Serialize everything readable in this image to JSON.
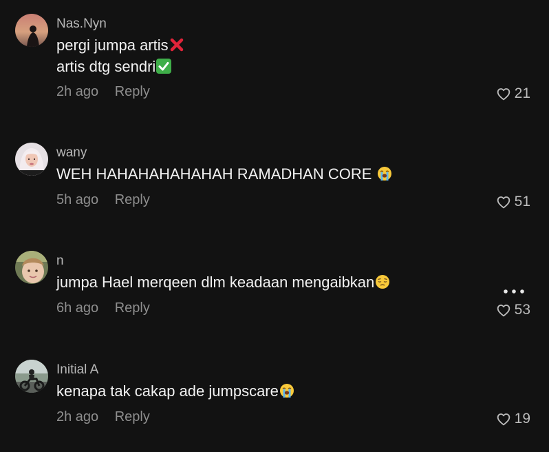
{
  "comments": [
    {
      "username": "Nas.Nyn",
      "lines": [
        "pergi jumpa artis",
        "artis dtg sendri"
      ],
      "line_emojis": [
        "cross-mark-emoji",
        "check-mark-emoji"
      ],
      "time": "2h ago",
      "reply_label": "Reply",
      "likes": "21"
    },
    {
      "username": "wany",
      "lines": [
        "WEH HAHAHAHAHAHAH RAMADHAN CORE "
      ],
      "line_emojis": [
        "loudly-crying-face-emoji"
      ],
      "time": "5h ago",
      "reply_label": "Reply",
      "likes": "51"
    },
    {
      "username": "n",
      "lines": [
        "jumpa Hael merqeen dlm keadaan mengaibkan"
      ],
      "line_emojis": [
        "pensive-face-emoji"
      ],
      "time": "6h ago",
      "reply_label": "Reply",
      "likes": "53",
      "more_icon": "more-options-icon"
    },
    {
      "username": "Initial A",
      "lines": [
        "kenapa tak cakap ade jumpscare"
      ],
      "line_emojis": [
        "loudly-crying-face-emoji"
      ],
      "time": "2h ago",
      "reply_label": "Reply",
      "likes": "19"
    }
  ],
  "icons": {
    "like": "heart-outline-icon"
  },
  "colors": {
    "background": "#121212",
    "username": "#b9b9b9",
    "text": "#f2f2f2",
    "meta": "#8e8e8e"
  }
}
